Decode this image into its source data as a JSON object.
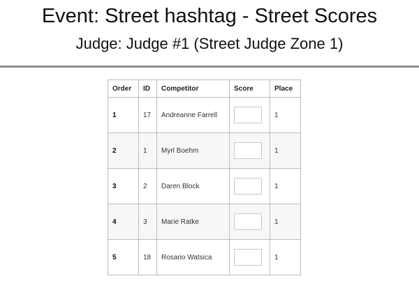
{
  "header": {
    "event_title": "Event: Street hashtag - Street Scores",
    "judge_title": "Judge: Judge #1 (Street Judge Zone 1)"
  },
  "table": {
    "columns": {
      "order": "Order",
      "id": "ID",
      "competitor": "Competitor",
      "score": "Score",
      "place": "Place"
    },
    "rows": [
      {
        "order": "1",
        "id": "17",
        "competitor": "Andreanne Farrell",
        "score": "",
        "place": "1"
      },
      {
        "order": "2",
        "id": "1",
        "competitor": "Myrl Boehm",
        "score": "",
        "place": "1"
      },
      {
        "order": "3",
        "id": "2",
        "competitor": "Daren Block",
        "score": "",
        "place": "1"
      },
      {
        "order": "4",
        "id": "3",
        "competitor": "Marie Ratke",
        "score": "",
        "place": "1"
      },
      {
        "order": "5",
        "id": "18",
        "competitor": "Rosario Watsica",
        "score": "",
        "place": "1"
      }
    ]
  },
  "colors": {
    "divider": "#8c8c8c",
    "border": "#bbbbbb",
    "stripe": "#f7f7f7"
  }
}
